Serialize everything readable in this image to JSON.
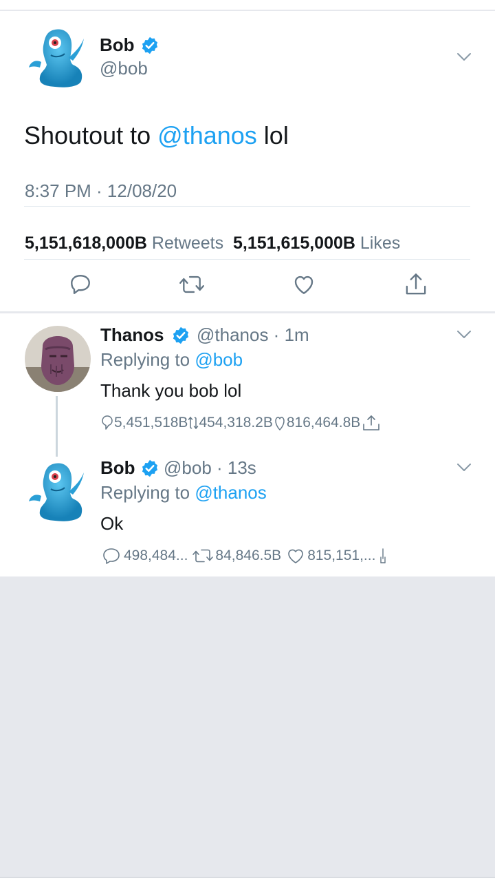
{
  "main_tweet": {
    "name": "Bob",
    "handle": "@bob",
    "text_prefix": "Shoutout to ",
    "mention": "@thanos",
    "text_suffix": " lol",
    "timestamp": "8:37 PM · 12/08/20",
    "retweets_count": "5,151,618,000B",
    "retweets_label": "Retweets",
    "likes_count": "5,151,615,000B",
    "likes_label": "Likes",
    "actions": [
      "reply-icon",
      "retweet-icon",
      "like-icon",
      "share-icon"
    ]
  },
  "replies": [
    {
      "name": "Thanos",
      "handle": "@thanos · 1m",
      "replying_prefix": "Replying to ",
      "replying_to": "@bob",
      "text": "Thank you bob lol",
      "reply_count": "5,451,518B",
      "retweet_count": "454,318.2B",
      "like_count": "816,464.8B"
    },
    {
      "name": "Bob",
      "handle": "@bob · 13s",
      "replying_prefix": "Replying to ",
      "replying_to": "@thanos",
      "text": "Ok",
      "reply_count": "498,484...",
      "retweet_count": "84,846.5B",
      "like_count": "815,151,..."
    }
  ],
  "colors": {
    "link": "#1da1f2",
    "secondary_text": "#657786",
    "background": "#e6e8ed"
  }
}
